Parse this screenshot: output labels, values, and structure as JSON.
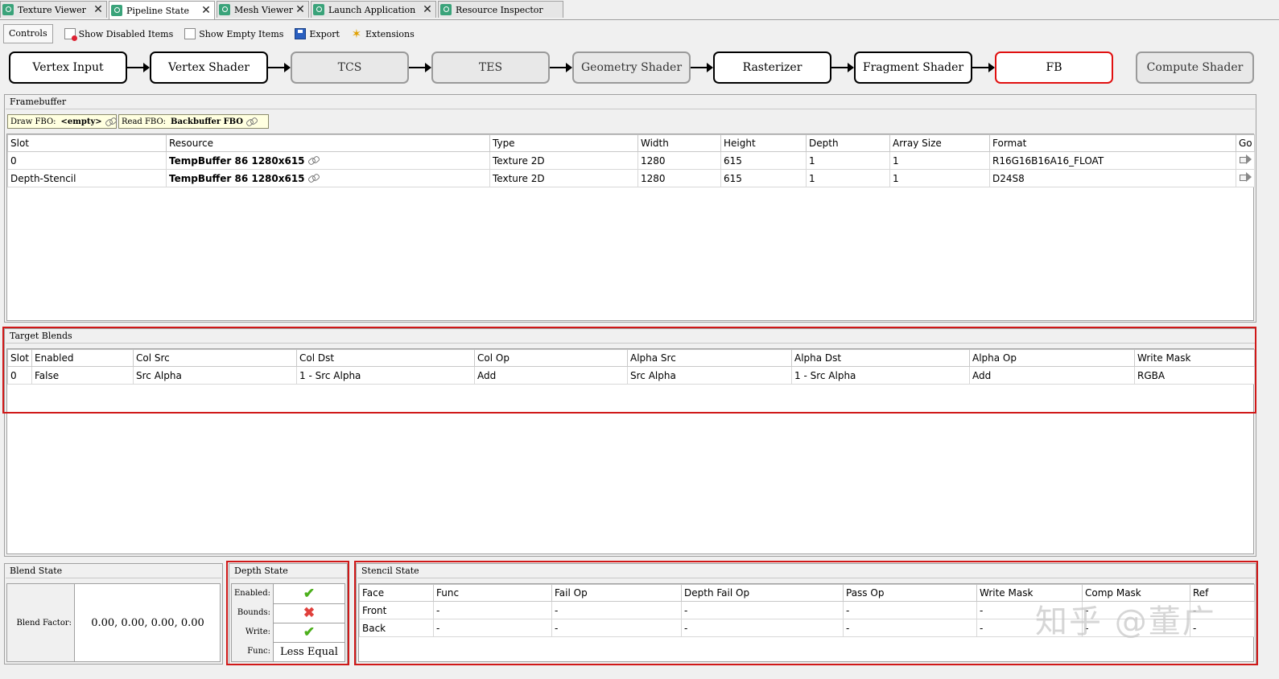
{
  "tabs": [
    {
      "label": "Texture Viewer",
      "active": false
    },
    {
      "label": "Pipeline State",
      "active": true
    },
    {
      "label": "Mesh Viewer",
      "active": false
    },
    {
      "label": "Launch Application",
      "active": false
    },
    {
      "label": "Resource Inspector",
      "active": false
    }
  ],
  "tab_close": "✕",
  "toolbar": {
    "controls_label": "Controls",
    "show_disabled": "Show Disabled Items",
    "show_empty": "Show Empty Items",
    "export": "Export",
    "extensions": "Extensions"
  },
  "pipeline": {
    "stages": [
      {
        "label": "Vertex Input",
        "state": "enabled"
      },
      {
        "label": "Vertex Shader",
        "state": "enabled"
      },
      {
        "label": "TCS",
        "state": "disabled"
      },
      {
        "label": "TES",
        "state": "disabled"
      },
      {
        "label": "Geometry Shader",
        "state": "disabled"
      },
      {
        "label": "Rasterizer",
        "state": "enabled"
      },
      {
        "label": "Fragment Shader",
        "state": "enabled"
      },
      {
        "label": "FB",
        "state": "selected"
      },
      {
        "label": "Compute Shader",
        "state": "disabled"
      }
    ]
  },
  "framebuffer": {
    "title": "Framebuffer",
    "draw_fbo_label": "Draw FBO:",
    "draw_fbo_value": "<empty>",
    "read_fbo_label": "Read FBO:",
    "read_fbo_value": "Backbuffer FBO",
    "columns": [
      "Slot",
      "Resource",
      "Type",
      "Width",
      "Height",
      "Depth",
      "Array Size",
      "Format",
      "Go"
    ],
    "rows": [
      {
        "slot": "0",
        "resource": "TempBuffer 86 1280x615",
        "type": "Texture 2D",
        "width": "1280",
        "height": "615",
        "depth": "1",
        "array_size": "1",
        "format": "R16G16B16A16_FLOAT"
      },
      {
        "slot": "Depth-Stencil",
        "resource": "TempBuffer 86 1280x615",
        "type": "Texture 2D",
        "width": "1280",
        "height": "615",
        "depth": "1",
        "array_size": "1",
        "format": "D24S8"
      }
    ]
  },
  "target_blends": {
    "title": "Target Blends",
    "columns": [
      "Slot",
      "Enabled",
      "Col Src",
      "Col Dst",
      "Col Op",
      "Alpha Src",
      "Alpha Dst",
      "Alpha Op",
      "Write Mask"
    ],
    "rows": [
      {
        "slot": "0",
        "enabled": "False",
        "col_src": "Src Alpha",
        "col_dst": "1 - Src Alpha",
        "col_op": "Add",
        "alpha_src": "Src Alpha",
        "alpha_dst": "1 - Src Alpha",
        "alpha_op": "Add",
        "write_mask": "RGBA"
      }
    ]
  },
  "blend_state": {
    "title": "Blend State",
    "factor_label": "Blend Factor:",
    "factor_value": "0.00, 0.00, 0.00, 0.00"
  },
  "depth_state": {
    "title": "Depth State",
    "rows": [
      {
        "key": "Enabled:",
        "icon": "check-icon"
      },
      {
        "key": "Bounds:",
        "icon": "cross-icon"
      },
      {
        "key": "Write:",
        "icon": "check-icon"
      },
      {
        "key": "Func:",
        "value": "Less Equal"
      }
    ]
  },
  "stencil_state": {
    "title": "Stencil State",
    "columns": [
      "Face",
      "Func",
      "Fail Op",
      "Depth Fail Op",
      "Pass Op",
      "Write Mask",
      "Comp Mask",
      "Ref"
    ],
    "rows": [
      {
        "face": "Front",
        "func": "-",
        "fail_op": "-",
        "depth_fail_op": "-",
        "pass_op": "-",
        "write_mask": "-",
        "comp_mask": "-",
        "ref": "-"
      },
      {
        "face": "Back",
        "func": "-",
        "fail_op": "-",
        "depth_fail_op": "-",
        "pass_op": "-",
        "write_mask": "-",
        "comp_mask": "-",
        "ref": "-"
      }
    ]
  },
  "watermark": "知乎 @董广",
  "colors": {
    "highlight": "#d01818",
    "check": "#4caf1c",
    "cross": "#e0403c"
  }
}
